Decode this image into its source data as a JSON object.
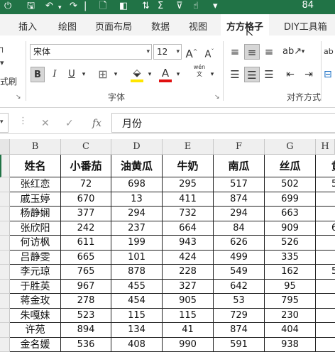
{
  "titlebar": {
    "zoom_count": "84"
  },
  "tabs": [
    "插入",
    "绘图",
    "页面布局",
    "数据",
    "视图",
    "方方格子",
    "DIY工具箱"
  ],
  "active_tab": "方方格子",
  "ribbon": {
    "left_partial_label": "式刷",
    "font_name": "宋体",
    "font_size": "12",
    "bold": "B",
    "italic": "I",
    "underline": "U",
    "phonetic": "wén",
    "font_group_label": "字体",
    "align_group_label": "对齐方式",
    "right_partial": "ab"
  },
  "formula_bar": {
    "fx": "fx",
    "content": "月份"
  },
  "sheet": {
    "columns": [
      "B",
      "C",
      "D",
      "E",
      "F",
      "G",
      "H"
    ],
    "headers": [
      "姓名",
      "小番茄",
      "油黄瓜",
      "牛奶",
      "南瓜",
      "丝瓜",
      "黄"
    ],
    "rows": [
      [
        "张红恋",
        "72",
        "698",
        "295",
        "517",
        "502",
        "5"
      ],
      [
        "戚玉婷",
        "670",
        "13",
        "411",
        "874",
        "699",
        ""
      ],
      [
        "杨静娴",
        "377",
        "294",
        "732",
        "294",
        "663",
        ""
      ],
      [
        "张欣阳",
        "242",
        "237",
        "664",
        "84",
        "909",
        "6"
      ],
      [
        "何访枫",
        "611",
        "199",
        "943",
        "626",
        "526",
        ""
      ],
      [
        "吕静雯",
        "665",
        "101",
        "424",
        "499",
        "335",
        ""
      ],
      [
        "李元琼",
        "765",
        "878",
        "228",
        "549",
        "162",
        "5"
      ],
      [
        "于胜英",
        "967",
        "455",
        "327",
        "642",
        "95",
        ""
      ],
      [
        "蒋金玫",
        "278",
        "454",
        "905",
        "53",
        "795",
        ""
      ],
      [
        "朱嘎妹",
        "523",
        "115",
        "115",
        "729",
        "230",
        ""
      ],
      [
        "许苑",
        "894",
        "134",
        "41",
        "874",
        "404",
        ""
      ],
      [
        "金名媛",
        "536",
        "408",
        "990",
        "591",
        "938",
        ""
      ]
    ]
  }
}
